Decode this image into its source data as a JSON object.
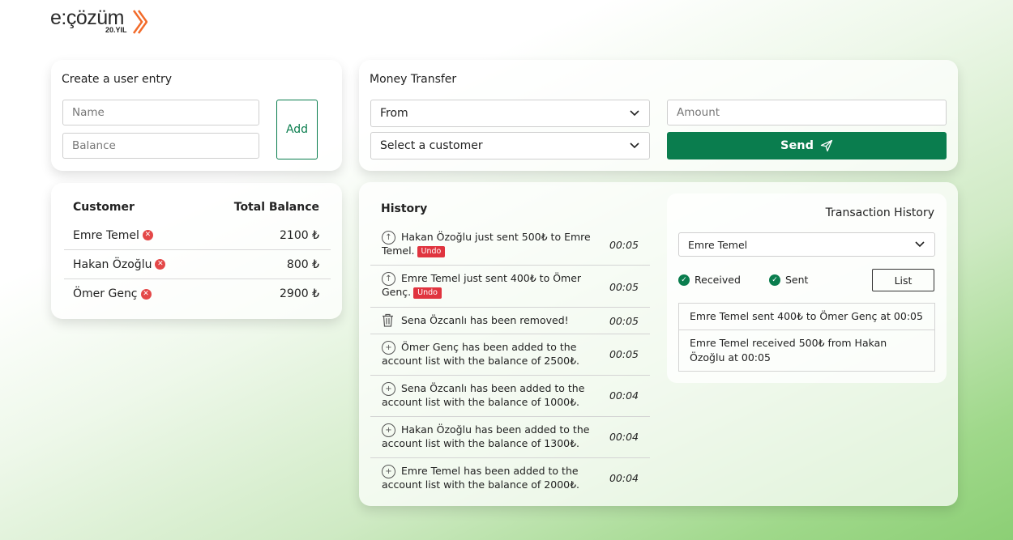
{
  "brand": {
    "word": "e:çözüm",
    "sub": "20.YIL"
  },
  "create_entry": {
    "title": "Create a user entry",
    "name_placeholder": "Name",
    "balance_placeholder": "Balance",
    "add_label": "Add"
  },
  "transfer": {
    "title": "Money Transfer",
    "from_label": "From",
    "customer_label": "Select a customer",
    "amount_placeholder": "Amount",
    "send_label": "Send"
  },
  "customers": {
    "col_customer": "Customer",
    "col_balance": "Total Balance",
    "rows": [
      {
        "name": "Emre Temel",
        "balance": "2100 ₺"
      },
      {
        "name": "Hakan Özoğlu",
        "balance": "800 ₺"
      },
      {
        "name": "Ömer Genç",
        "balance": "2900 ₺"
      }
    ]
  },
  "history": {
    "title": "History",
    "undo_label": "Undo",
    "items": [
      {
        "icon": "arrow-up-circle-icon",
        "text": "Hakan Özoğlu just sent 500₺ to Emre Temel.",
        "undo": true,
        "time": "00:05"
      },
      {
        "icon": "arrow-up-circle-icon",
        "text": "Emre Temel just sent 400₺ to Ömer Genç.",
        "undo": true,
        "time": "00:05"
      },
      {
        "icon": "trash-icon",
        "text": "Sena Özcanlı has been removed!",
        "undo": false,
        "time": "00:05"
      },
      {
        "icon": "plus-circle-icon",
        "text": "Ömer Genç has been added to the account list with the balance of 2500₺.",
        "undo": false,
        "time": "00:05"
      },
      {
        "icon": "plus-circle-icon",
        "text": "Sena Özcanlı has been added to the account list with the balance of 1000₺.",
        "undo": false,
        "time": "00:04"
      },
      {
        "icon": "plus-circle-icon",
        "text": "Hakan Özoğlu has been added to the account list with the balance of 1300₺.",
        "undo": false,
        "time": "00:04"
      },
      {
        "icon": "plus-circle-icon",
        "text": "Emre Temel has been added to the account list with the balance of 2000₺.",
        "undo": false,
        "time": "00:04"
      }
    ]
  },
  "transaction_history": {
    "title": "Transaction History",
    "selected_customer": "Emre Temel",
    "received_label": "Received",
    "sent_label": "Sent",
    "list_label": "List",
    "entries": [
      "Emre Temel sent 400₺ to Ömer Genç at 00:05",
      "Emre Temel received 500₺ from Hakan Özoğlu at 00:05"
    ]
  },
  "colors": {
    "accent": "#0a7d4e",
    "danger": "#e44848",
    "brand_orange": "#f26b2a"
  }
}
